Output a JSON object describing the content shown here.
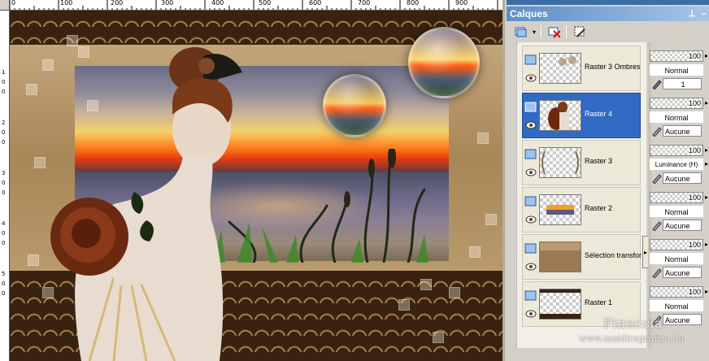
{
  "ruler": {
    "top_labels": [
      "0",
      "100",
      "200",
      "300",
      "400",
      "500",
      "600",
      "700",
      "800",
      "900"
    ],
    "left_labels": [
      "1",
      "0",
      "0",
      "2",
      "0",
      "0",
      "3",
      "0",
      "0",
      "4",
      "0",
      "0",
      "5",
      "0",
      "0"
    ]
  },
  "panel": {
    "title": "Calques",
    "pin_icon": "pin-icon",
    "minimize_icon": "minimize-icon"
  },
  "toolbar": {
    "buttons": [
      "new-layer-icon",
      "delete-layer-icon",
      "mask-icon"
    ]
  },
  "layers": [
    {
      "name": "Raster 3 Ombres",
      "selected": false
    },
    {
      "name": "Raster 4",
      "selected": true
    },
    {
      "name": "Raster 3",
      "selected": false
    },
    {
      "name": "Raster 2",
      "selected": false
    },
    {
      "name": "Sélection transforn",
      "selected": false
    },
    {
      "name": "Raster 1",
      "selected": false
    }
  ],
  "props": [
    {
      "opacity": "100",
      "blend": "Normal",
      "group": "1"
    },
    {
      "opacity": "100",
      "blend": "Normal",
      "group": "Aucune"
    },
    {
      "opacity": "100",
      "blend": "Luminance (H)",
      "group": "Aucune"
    },
    {
      "opacity": "100",
      "blend": "Normal",
      "group": "Aucune"
    },
    {
      "opacity": "100",
      "blend": "Normal",
      "group": "Aucune"
    },
    {
      "opacity": "100",
      "blend": "Normal",
      "group": "Aucune"
    }
  ],
  "watermark": {
    "name": "Pinuccia",
    "site": "www.maidiregrafica.eu"
  },
  "colors": {
    "selection": "#316ac5",
    "title_bar": "#5b8ec8"
  }
}
